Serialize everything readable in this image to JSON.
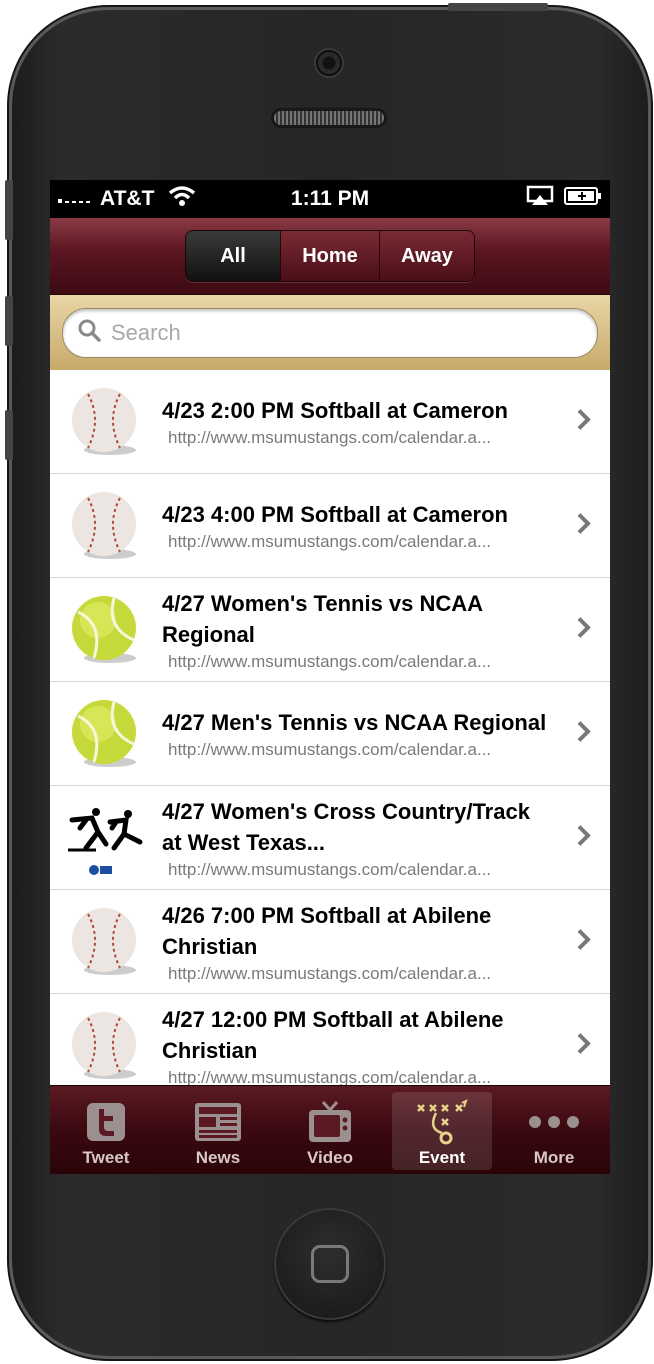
{
  "status_bar": {
    "carrier": "AT&T",
    "time": "1:11 PM"
  },
  "segmented": {
    "options": [
      "All",
      "Home",
      "Away"
    ],
    "selected": "All"
  },
  "search": {
    "placeholder": "Search",
    "value": ""
  },
  "events": [
    {
      "icon": "baseball",
      "title": "4/23 2:00 PM Softball at Cameron",
      "url": "http://www.msumustangs.com/calendar.a..."
    },
    {
      "icon": "baseball",
      "title": "4/23 4:00 PM Softball at Cameron",
      "url": "http://www.msumustangs.com/calendar.a..."
    },
    {
      "icon": "tennis-ball",
      "title": "4/27 Women's Tennis vs  NCAA Regional",
      "url": "http://www.msumustangs.com/calendar.a..."
    },
    {
      "icon": "tennis-ball",
      "title": "4/27 Men's Tennis vs  NCAA Regional",
      "url": "http://www.msumustangs.com/calendar.a..."
    },
    {
      "icon": "runners",
      "title": "4/27 Women's Cross Country/Track at  West Texas...",
      "url": "http://www.msumustangs.com/calendar.a..."
    },
    {
      "icon": "baseball",
      "title": "4/26 7:00 PM Softball at  Abilene Christian",
      "url": "http://www.msumustangs.com/calendar.a..."
    },
    {
      "icon": "baseball",
      "title": "4/27 12:00 PM Softball at  Abilene Christian",
      "url": "http://www.msumustangs.com/calendar.a..."
    }
  ],
  "tabs": [
    {
      "label": "Tweet",
      "icon": "twitter-icon"
    },
    {
      "label": "News",
      "icon": "newspaper-icon"
    },
    {
      "label": "Video",
      "icon": "tv-icon"
    },
    {
      "label": "Event",
      "icon": "playbook-icon",
      "active": true
    },
    {
      "label": "More",
      "icon": "more-icon"
    }
  ],
  "colors": {
    "nav_maroon": "#5a1520",
    "search_gold": "#d4b97e",
    "tab_maroon": "#3b0910"
  }
}
